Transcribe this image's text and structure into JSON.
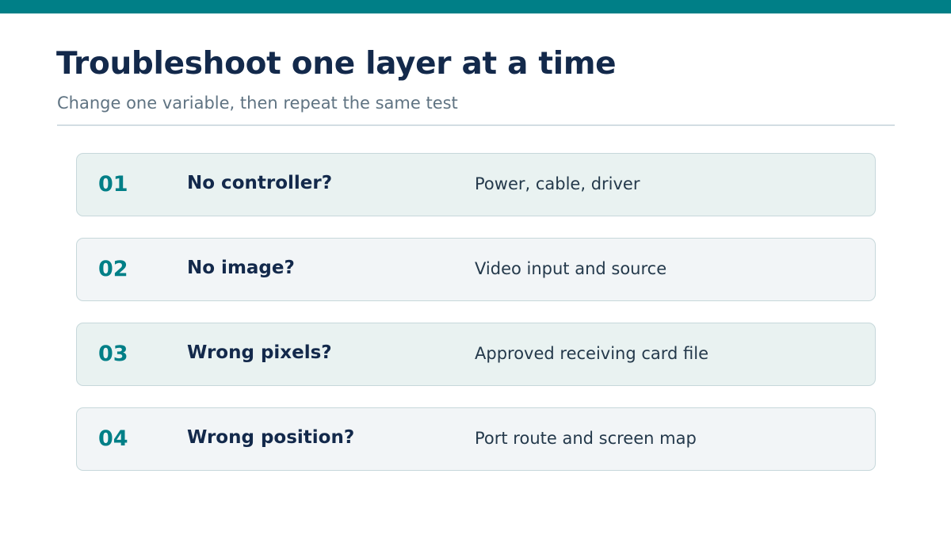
{
  "slide": {
    "title": "Troubleshoot one layer at a time",
    "subtitle": "Change one variable, then repeat the same test"
  },
  "steps": [
    {
      "number": "01",
      "question": "No controller?",
      "answer": "Power, cable, driver"
    },
    {
      "number": "02",
      "question": "No image?",
      "answer": "Video input and source"
    },
    {
      "number": "03",
      "question": "Wrong pixels?",
      "answer": "Approved receiving card file"
    },
    {
      "number": "04",
      "question": "Wrong position?",
      "answer": "Port route and screen map"
    }
  ],
  "colors": {
    "accent": "#007f87",
    "title": "#13294b",
    "subtitle": "#5f7382",
    "card_tint": "#e9f2f1",
    "card_neutral": "#f2f5f7",
    "card_border": "#c7d8db"
  }
}
